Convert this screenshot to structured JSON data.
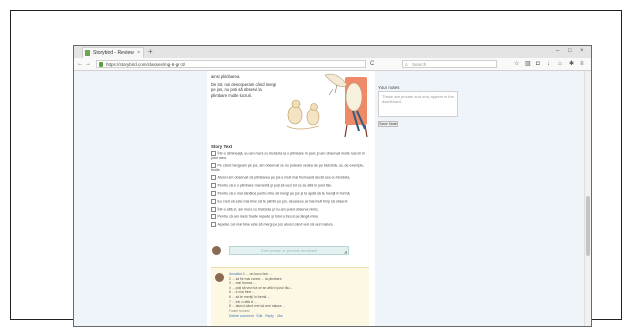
{
  "browser": {
    "tab_title": "Storybird - Review",
    "tab_close": "×",
    "new_tab": "+",
    "window_controls": [
      "–",
      "□",
      "×"
    ],
    "nav_back": "←",
    "nav_forward": "→",
    "url": "https://storybird.com/classes/mg-6-gr-3/",
    "url_reload": "C",
    "search_placeholder": "Search",
    "toolbar_icons": [
      "bookmark-star-icon",
      "library-icon",
      "pocket-icon",
      "download-icon",
      "home-icon",
      "extension-icon",
      "menu-icon"
    ]
  },
  "illustration": {
    "text_p1": "ainsi plimbarea.",
    "text_p2": "De tot, noi descoperam când mergi pe jos, nu poti să observi la plimbare multe lucruri."
  },
  "sidebar": {
    "label": "Your notes",
    "placeholder": "These are private and only appear in the dashboard.",
    "button": "Save Note"
  },
  "story": {
    "title": "Story Text",
    "items": [
      "Într-o dimineaţă, eu am mers cu bicicleta la o plimbare în parc şi am observat multe lucruri în jurul meu.",
      "Pe când mergeam pe jos, am observat ce nu puteam vedea de pe bicicletă, ca, de exemplu, florile.",
      "Atunci am observat că plimbarea pe jos e mult mai frumoasă decât cea cu bicicleta.",
      "Pentru că e o plimbare mai lentă şi poţi să vezi tot ce se află în jurul tău.",
      "Pentru că e mai sănătos pentru tine să mergi pe jos şi te ajută să te menţii în formă.",
      "Eu cred că este mai bine să te plimbi pe jos, deoarece ai mai mult timp să observi.",
      "Într-o altă zi, am mers cu bicicleta şi nu am putut observa nimic.",
      "Pentru că am mers foarte repede şi totul a trecut pe lângă mine.",
      "Aşadar, cel mai bine este să mergi pe jos atunci când vrei să vezi natura."
    ]
  },
  "comment_box": {
    "placeholder": "Give praise or provide feedback"
  },
  "comment": {
    "author": "Annalisa",
    "lines": [
      "1 ... un lucru bun ...",
      "2 ... să fie mai corect ... la plimbare",
      "3 ... mai frumos ...",
      "4 ... poţi să vezi tot ce se află în jurul tău ...",
      "5 ... e mai bine ...",
      "6 ... să te menţii în formă ...",
      "7 ... într-o altă zi ...",
      "8 ... atunci când vrei să vezi natura ..."
    ],
    "footer": "Foarte frumos!",
    "actions": [
      "Delete comment",
      "Edit",
      "Reply",
      "Like"
    ]
  }
}
